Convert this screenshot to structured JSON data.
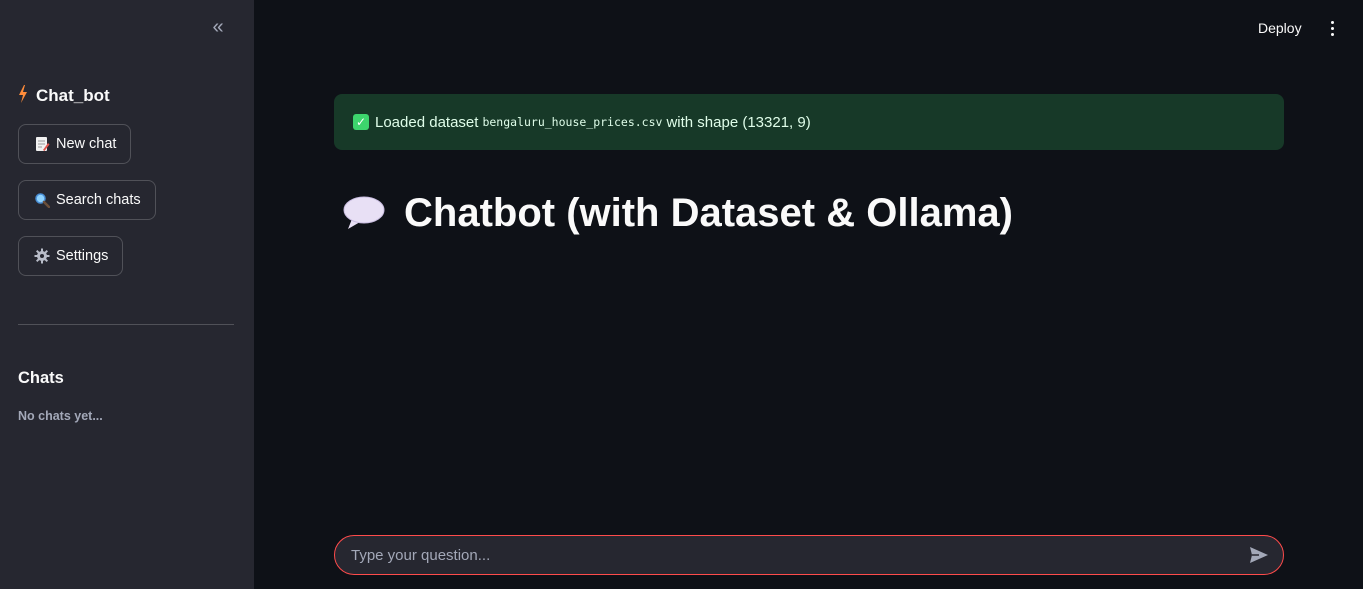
{
  "header": {
    "deploy_label": "Deploy",
    "menu_icon": "kebab-menu-icon"
  },
  "sidebar": {
    "collapse_glyph": "«",
    "title": "Chat_bot",
    "title_icon": "lightning-icon",
    "buttons": [
      {
        "label": "New chat",
        "icon": "memo-icon"
      },
      {
        "label": "Search chats",
        "icon": "magnifier-icon"
      },
      {
        "label": "Settings",
        "icon": "gear-icon"
      }
    ],
    "chats_heading": "Chats",
    "empty_text": "No chats yet..."
  },
  "alert": {
    "prefix": "Loaded dataset",
    "filename": "bengaluru_house_prices.csv",
    "suffix": "with shape (13321, 9)",
    "check_glyph": "✓"
  },
  "main": {
    "title": "Chatbot (with Dataset & Ollama)",
    "title_icon": "speech-bubble-icon"
  },
  "chat_input": {
    "placeholder": "Type your question...",
    "value": ""
  },
  "colors": {
    "sidebar_bg": "#262730",
    "main_bg": "#0e1117",
    "success_bg": "#173928",
    "accent": "#ff4b4b"
  }
}
